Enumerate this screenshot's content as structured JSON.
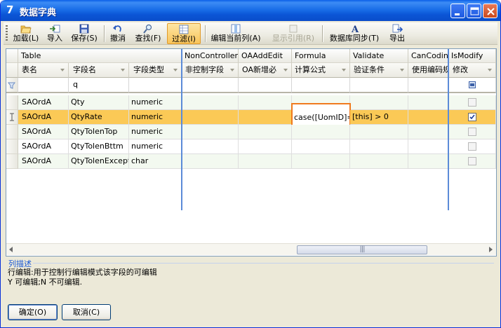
{
  "window": {
    "title": "数据字典",
    "app_icon": "7"
  },
  "toolbar": {
    "load": "加载(L)",
    "import": "导入",
    "save": "保存(S)",
    "undo": "撤消",
    "find": "查找(F)",
    "filter": "过滤(I)",
    "edit_current_column": "编辑当前列(A)",
    "show_reference": "显示引用(R)",
    "db_sync": "数据库同步(T)",
    "export": "导出"
  },
  "grid": {
    "bands": {
      "table": "Table",
      "noncontroller": "NonController",
      "oaaddedit": "OAAddEdit",
      "formula": "Formula",
      "validate": "Validate",
      "cancoding": "CanCoding",
      "ismodify": "IsModify"
    },
    "headers": {
      "table_name": "表名",
      "field_name": "字段名",
      "field_type": "字段类型",
      "noncontroller": "非控制字段",
      "oaaddedit": "OA新增必",
      "formula": "计算公式",
      "validate": "验证条件",
      "cancoding": "使用编码规",
      "ismodify": "修改"
    },
    "filter_field_name": "q",
    "rows": [
      {
        "table": "SAOrdA",
        "field": "Qty",
        "type": "numeric",
        "formula": "",
        "validate": ""
      },
      {
        "table": "SAOrdA",
        "field": "QtyRate",
        "type": "numeric",
        "formula": "case([UomID]='",
        "validate": "[this] > 0"
      },
      {
        "table": "SAOrdA",
        "field": "QtyTolenTop",
        "type": "numeric",
        "formula": "",
        "validate": ""
      },
      {
        "table": "SAOrdA",
        "field": "QtyTolenBttm",
        "type": "numeric",
        "formula": "",
        "validate": ""
      },
      {
        "table": "SAOrdA",
        "field": "QtyTolenExcept",
        "type": "char",
        "formula": "",
        "validate": ""
      }
    ],
    "scroll_thumb": "|||"
  },
  "description": {
    "title": "列描述",
    "line1": "行编辑:用于控制行编辑模式该字段的可编辑",
    "line2": "Y 可编辑;N 不可编辑."
  },
  "buttons": {
    "ok": "确定(O)",
    "cancel": "取消(C)"
  },
  "colors": {
    "selected_row": "#fbc956",
    "alt_row": "#f3f9f0",
    "highlight_border": "#f07a1e"
  }
}
